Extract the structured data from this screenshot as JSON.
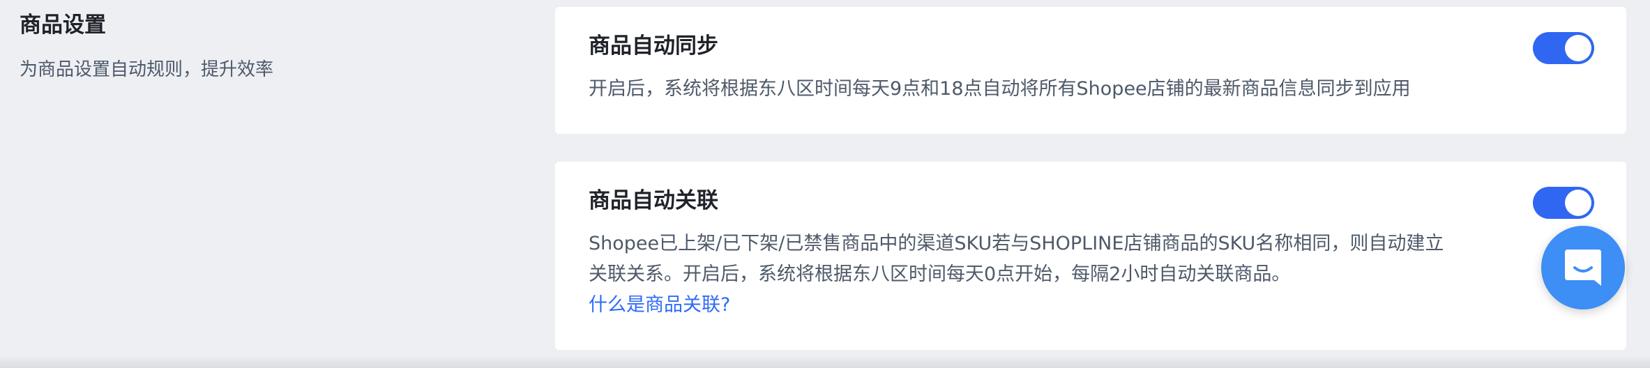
{
  "section": {
    "title": "商品设置",
    "description": "为商品设置自动规则，提升效率"
  },
  "cards": [
    {
      "title": "商品自动同步",
      "description": "开启后，系统将根据东八区时间每天9点和18点自动将所有Shopee店铺的最新商品信息同步到应用",
      "toggle_on": true
    },
    {
      "title": "商品自动关联",
      "description": "Shopee已上架/已下架/已禁售商品中的渠道SKU若与SHOPLINE店铺商品的SKU名称相同，则自动建立关联关系。开启后，系统将根据东八区时间每天0点开始，每隔2小时自动关联商品。",
      "link": "什么是商品关联?",
      "toggle_on": true
    }
  ],
  "colors": {
    "toggle_on": "#3067f2",
    "link": "#2f6bf5",
    "chat_button": "#3d8ef5"
  },
  "icons": {
    "chat": "chat-bubble-smile-icon"
  }
}
